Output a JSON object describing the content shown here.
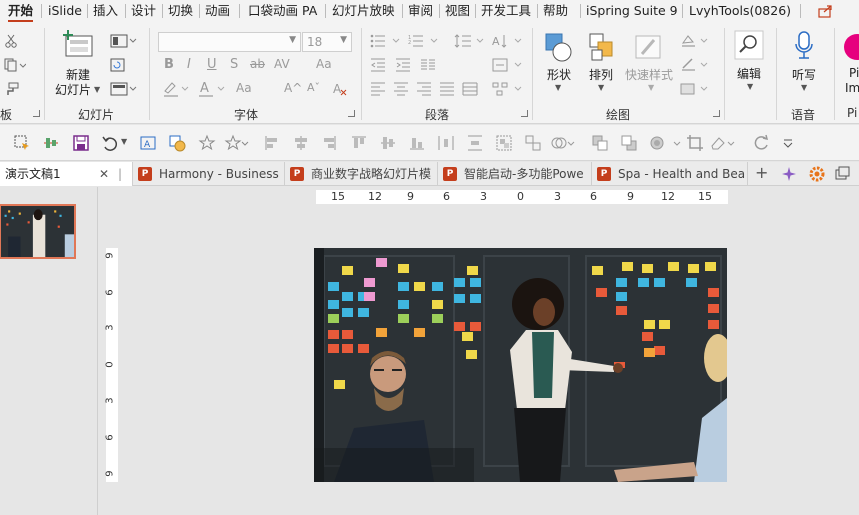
{
  "menu": {
    "tabs": [
      "开始",
      "iSlide",
      "插入",
      "设计",
      "切换",
      "动画",
      "口袋动画 PA",
      "幻灯片放映",
      "审阅",
      "视图",
      "开发工具",
      "帮助",
      "iSpring Suite 9",
      "LvyhTools(0826)"
    ],
    "active": "开始"
  },
  "ribbon": {
    "groups": {
      "clipboard_label": "板",
      "slides_label": "幻灯片",
      "font_label": "字体",
      "paragraph_label": "段落",
      "drawing_label": "绘图",
      "voice_label": "语音",
      "pi_label": "Pi"
    },
    "new_slide": {
      "line1": "新建",
      "line2": "幻灯片"
    },
    "font": {
      "name_value": "",
      "size_value": "18"
    },
    "shape_label": "形状",
    "arrange_label": "排列",
    "quick_style_label": "快速样式",
    "edit_label": "编辑",
    "dictate_label": "听写",
    "pi_partial": "Pi",
    "im_partial": "Im"
  },
  "doc_tabs": [
    {
      "label": "演示文稿1",
      "active": true
    },
    {
      "label": "Harmony - Business",
      "active": false
    },
    {
      "label": "商业数字战略幻灯片模",
      "active": false
    },
    {
      "label": "智能启动-多功能Powe",
      "active": false
    },
    {
      "label": "Spa - Health and Bea",
      "active": false
    }
  ],
  "doc_tab_close": "✕",
  "doc_tab_add": "+",
  "rulers": {
    "horizontal": [
      "15",
      "12",
      "9",
      "6",
      "3",
      "0",
      "3",
      "6",
      "9",
      "12",
      "15"
    ],
    "vertical": [
      "9",
      "6",
      "3",
      "0",
      "3",
      "6",
      "9"
    ]
  },
  "slide_thumbnail_number": "1",
  "colors": {
    "accent": "#c43e1c",
    "ribbon_bg": "#f3f3f3",
    "workspace_bg": "#e6e6e6"
  }
}
